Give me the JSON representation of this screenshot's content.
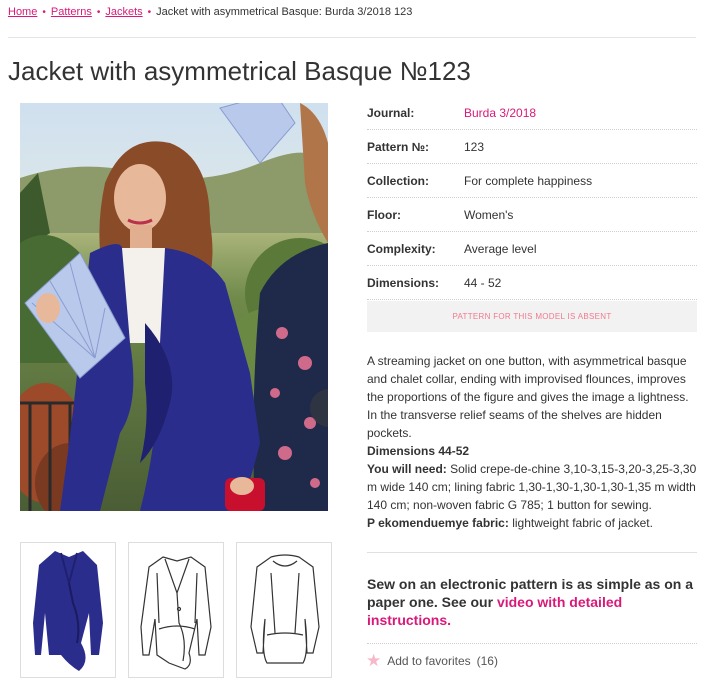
{
  "breadcrumb": {
    "items": [
      "Home",
      "Patterns",
      "Jackets"
    ],
    "current": "Jacket with asymmetrical Basque: Burda 3/2018 123"
  },
  "title": "Jacket with asymmetrical Basque №123",
  "gallery": {
    "next_arrow": "›",
    "main_image": "model-in-blue-jacket-with-fan",
    "thumbnails": [
      "jacket-photo",
      "jacket-front-sketch",
      "jacket-back-sketch"
    ]
  },
  "details": [
    {
      "label": "Journal:",
      "value": "Burda 3/2018",
      "link": true
    },
    {
      "label": "Pattern №:",
      "value": "123",
      "link": false
    },
    {
      "label": "Collection:",
      "value": "For complete happiness",
      "link": false
    },
    {
      "label": "Floor:",
      "value": "Women's",
      "link": false
    },
    {
      "label": "Complexity:",
      "value": "Average level",
      "link": false
    },
    {
      "label": "Dimensions:",
      "value": "44 - 52",
      "link": false
    }
  ],
  "absent_notice": "PATTERN FOR THIS MODEL IS ABSENT",
  "description": {
    "text": "A streaming jacket on one button, with asymmetrical basque and chalet collar, ending with improvised flounces, improves the proportions of the figure and gives the image a lightness. In the transverse relief seams of the shelves are hidden pockets.",
    "dimensions": "Dimensions 44-52",
    "need_label": "You will need:",
    "need_text": "Solid crepe-de-chine 3,10-3,15-3,20-3,25-3,30 m wide 140 cm; lining fabric 1,30-1,30-1,30-1,30-1,35 m width 140 cm; non-woven fabric G 785; 1 button for sewing.",
    "fabric_label": "P ekomenduemye fabric:",
    "fabric_text": "lightweight fabric of jacket."
  },
  "cta": {
    "text": "Sew on an electronic pattern is as simple as on a paper one. See our",
    "link": "video with detailed instructions."
  },
  "favorites": {
    "label": "Add to favorites",
    "count": "(16)"
  },
  "colors": {
    "accent": "#d9197a",
    "jacket": "#2b2d8c"
  }
}
